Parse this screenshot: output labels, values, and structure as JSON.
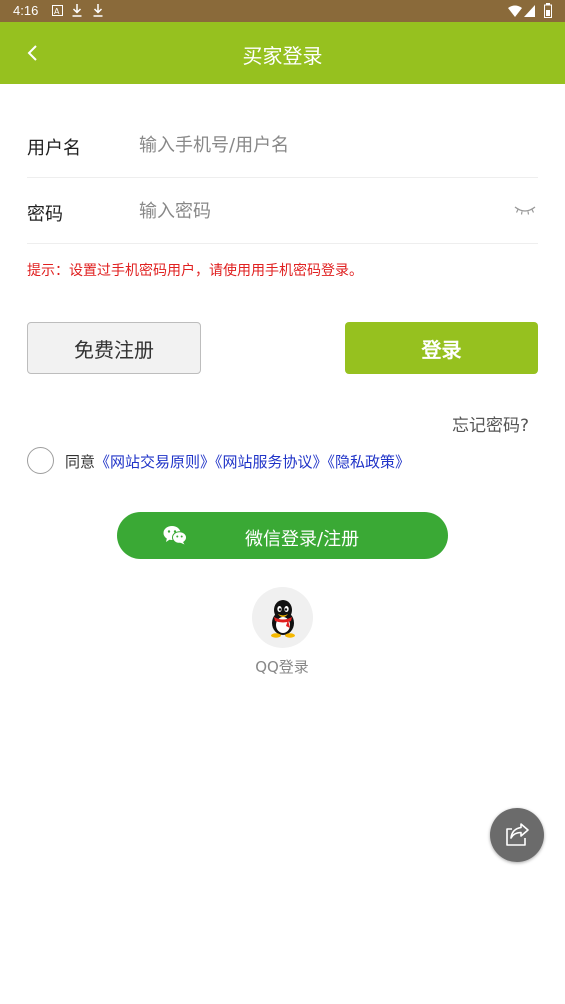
{
  "status_bar": {
    "time": "4:16"
  },
  "header": {
    "title": "买家登录",
    "back_icon": "chevron-left-icon"
  },
  "form": {
    "username_label": "用户名",
    "username_placeholder": "输入手机号/用户名",
    "username_value": "",
    "password_label": "密码",
    "password_placeholder": "输入密码",
    "password_value": ""
  },
  "hint": "提示：设置过手机密码用户，请使用用手机密码登录。",
  "buttons": {
    "register": "免费注册",
    "login": "登录"
  },
  "forgot_password": "忘记密码?",
  "agreement": {
    "prefix": "同意",
    "link1": "《网站交易原则》",
    "link2": "《网站服务协议》",
    "link3": "《隐私政策》",
    "checked": false
  },
  "wechat": {
    "label": "微信登录/注册"
  },
  "qq": {
    "label": "QQ登录"
  },
  "colors": {
    "brand_green": "#96c11f",
    "wechat_green": "#3aa935",
    "hint_red": "#e02020",
    "link_blue": "#2034c8"
  }
}
